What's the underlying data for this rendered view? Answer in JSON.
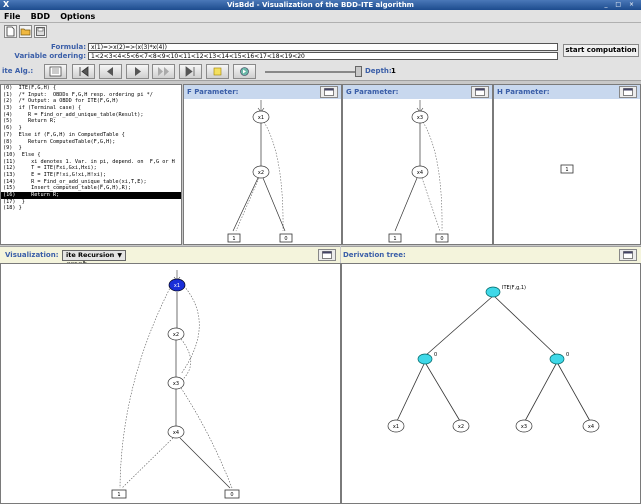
{
  "window": {
    "logo": "X",
    "title": "VisBdd - Visualization of the BDD-ITE algorithm",
    "controls": "_ □ ×"
  },
  "menu": [
    "File",
    "BDD",
    "Options"
  ],
  "form": {
    "formula_label": "Formula:",
    "formula_value": "x(1)=>x(2)=>(x(3)*x(4))",
    "ordering_label": "Variable ordering:",
    "ordering_value": "1<2<3<4<5<6<7<8<9<10<11<12<13<14<15<16<17<18<19<20",
    "start_button": "start computation"
  },
  "controls": {
    "ite_label": "ite Alg.:",
    "depth_label": "Depth:",
    "depth_value": "1"
  },
  "code_lines": [
    "(0)  ITE(F,G,H) {",
    "(1)  /* Input:  OBDDs F,G,H resp. ordering pi */",
    "(2)  /* Output: a OBDD for ITE(F,G,H)",
    "(3)  if (Terminal case) {",
    "(4)     R = Find_or_add_unique_table(Result);",
    "(5)     Return R;",
    "(6)  }",
    "(7)  Else if (F,G,H) in ComputedTable {",
    "(8)     Return ComputedTable(F,G,H);",
    "(9)  }",
    "(10)  Else {",
    "(11)     xi denotes 1. Var. in pi, depend. on  F,G or H",
    "(12)     T = ITE(Fxi,Gxi,Hxi);",
    "(13)     E = ITE(F!xi,G!xi,H!xi);",
    "(14)     R = Find_or_add_unique_table(xi,T,E);",
    "(15)     Insert_computed_table(F,G,H),R);",
    "(16)     Return R;",
    "(17)  }",
    "(18) }"
  ],
  "highlight_line": 16,
  "panels": {
    "f_title": "F Parameter:",
    "g_title": "G Parameter:",
    "h_title": "H Parameter:",
    "vis_label": "Visualization:",
    "vis_select": "ite Recursion graph",
    "deriv_title": "Derivation tree:"
  },
  "graphs": {
    "f_nodes": [
      "x1",
      "x2"
    ],
    "g_nodes": [
      "x3",
      "x4"
    ],
    "h_terminal": "1",
    "vis_nodes": [
      "x1",
      "x2",
      "x3",
      "x4"
    ],
    "terminals": [
      "1",
      "0"
    ],
    "deriv_root": "ITE(F,g,1)",
    "deriv_mid_left": "0",
    "deriv_mid_right": "0",
    "deriv_leaves": [
      "x1",
      "x2",
      "x3",
      "x4"
    ]
  },
  "colors": {
    "label_blue": "#3a5ea8",
    "panel_header": "#c8d8ee",
    "vis_bar": "#f4f4dc",
    "active_node": "#1a2fd8",
    "deriv_node": "#3fd8e8"
  }
}
